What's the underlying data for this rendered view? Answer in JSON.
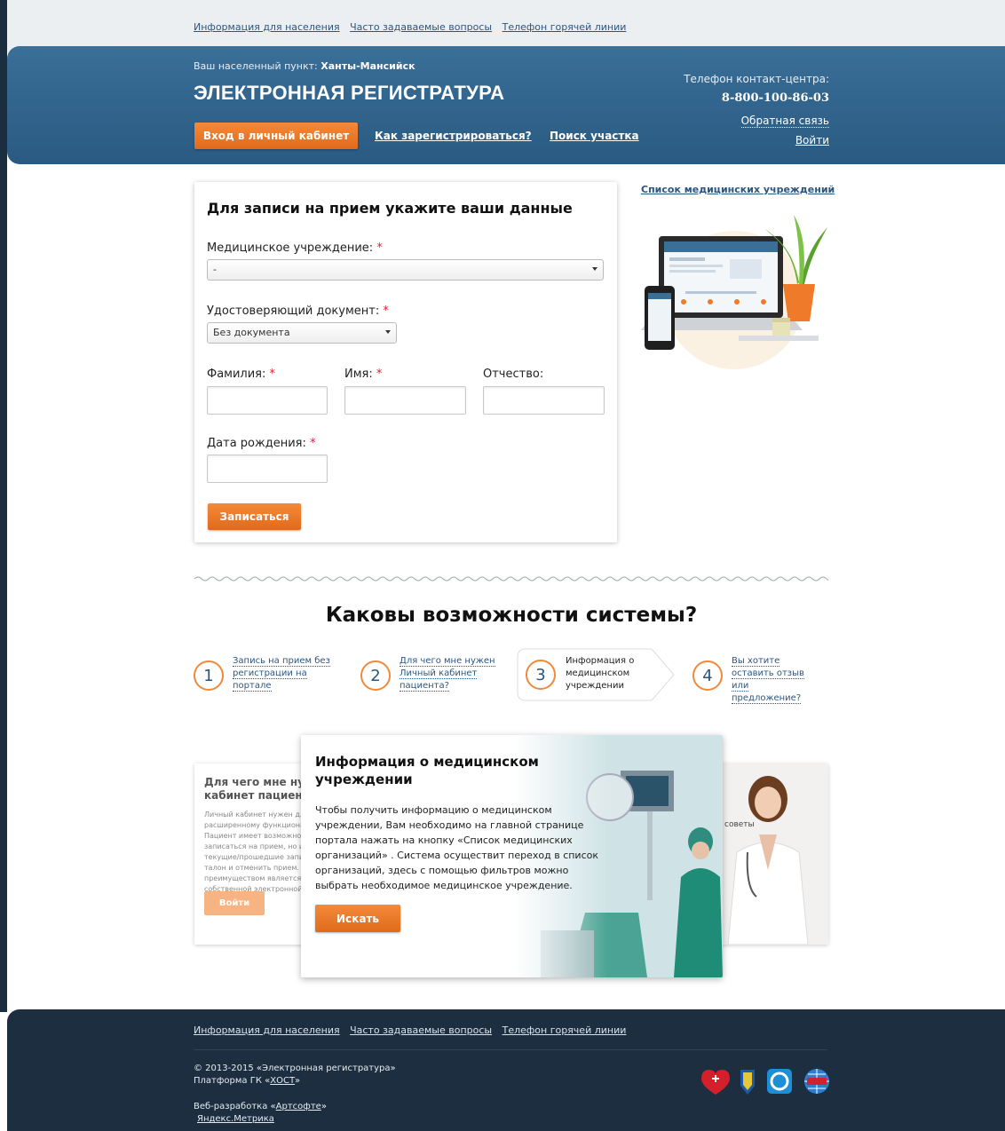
{
  "top_nav": {
    "links": [
      "Информация для населения",
      "Часто задаваемые вопросы",
      "Телефон горячей линии"
    ]
  },
  "header": {
    "city_prefix": "Ваш населенный пункт:",
    "city": "Ханты-Мансийск",
    "title": "ЭЛЕКТРОННАЯ РЕГИСТРАТУРА",
    "cabinet_button": "Вход в личный кабинет",
    "how_to_register": "Как зарегистрироваться?",
    "find_district": "Поиск участка",
    "contact_label": "Телефон контакт-центра:",
    "contact_phone": "8-800-100-86-03",
    "feedback": "Обратная связь",
    "login": "Войти"
  },
  "form": {
    "title": "Для записи на прием укажите ваши данные",
    "institution_label": "Медицинское учреждение:",
    "institution_value": "-",
    "document_label": "Удостоверяющий документ:",
    "document_value": "Без документа",
    "lastname_label": "Фамилия:",
    "firstname_label": "Имя:",
    "patronymic_label": "Отчество:",
    "birthdate_label": "Дата рождения:",
    "required_mark": "*",
    "submit": "Записаться"
  },
  "sidebar": {
    "institutions_link": "Список медицинских учреждений"
  },
  "features": {
    "title": "Каковы возможности системы?",
    "steps": [
      {
        "num": "1",
        "text": "Запись на прием без регистрации на портале"
      },
      {
        "num": "2",
        "text": "Для чего мне нужен Личный кабинет пациента?"
      },
      {
        "num": "3",
        "text": "Информация о медицинском учреждении"
      },
      {
        "num": "4",
        "text": "Вы хотите оставить отзыв или предложение?"
      }
    ],
    "active_step": 3,
    "back_card": {
      "title": "Для чего мне нужен Личный кабинет пациента?",
      "text": "Личный кабинет нужен для доступа к расширенному функционалу портала. Пациент имеет возможность не только записаться на прием, но и просмотреть свои текущие/прошедшие записи, распечатать талон и отменить прием. Основным преимуществом является ведение собственной электронной медицинской карты.",
      "button": "Войти"
    },
    "back_card_right_text": "советы",
    "active_card": {
      "title": "Информация о медицинском учреждении",
      "text": "Чтобы получить информацию о медицинском учреждении, Вам необходимо на главной странице портала нажать на кнопку «Список медицинских организаций» . Система осуществит переход в список организаций, здесь с помощью фильтров можно выбрать необходимое медицинское учреждение.",
      "button": "Искать"
    }
  },
  "footer": {
    "links": [
      "Информация для населения",
      "Часто задаваемые вопросы",
      "Телефон горячей линии"
    ],
    "copyright": "© 2013-2015 «Электронная регистратура»",
    "platform_prefix": "Платформа ГК «",
    "platform_name": "ХОСТ",
    "platform_suffix": "»",
    "dev_prefix": "Веб-разработка «",
    "dev_name": "Артсофте",
    "dev_suffix": "»",
    "metrika": "Яндекс.Метрика"
  },
  "colors": {
    "header_blue": "#2f6289",
    "accent_orange": "#ee7a2a",
    "footer_navy": "#1c2e40",
    "link_blue": "#2b5680"
  }
}
